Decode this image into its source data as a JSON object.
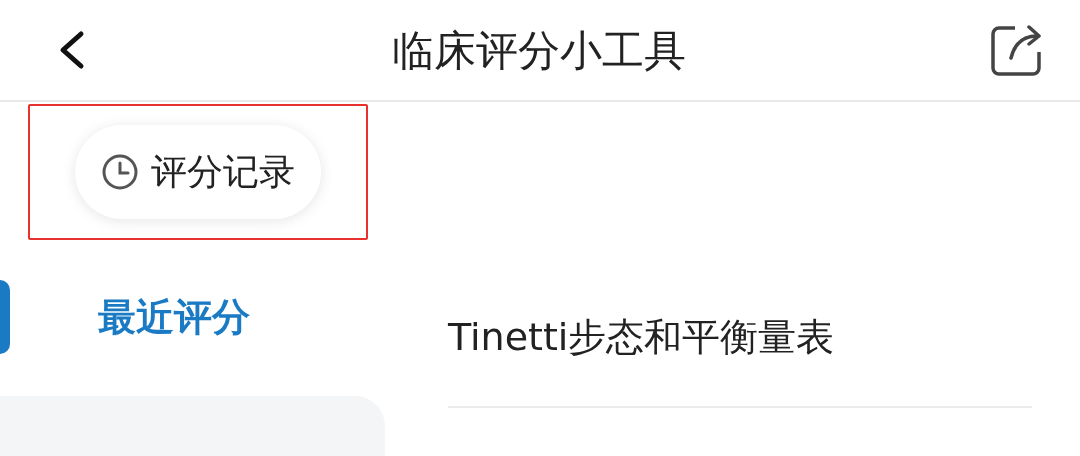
{
  "header": {
    "title": "临床评分小工具"
  },
  "history_button": {
    "label": "评分记录",
    "highlighted": true
  },
  "sidebar": {
    "items": [
      {
        "label": "最近评分",
        "selected": true
      },
      {
        "selected": false
      }
    ]
  },
  "list": {
    "items": [
      "Tinetti步态和平衡量表"
    ]
  }
}
